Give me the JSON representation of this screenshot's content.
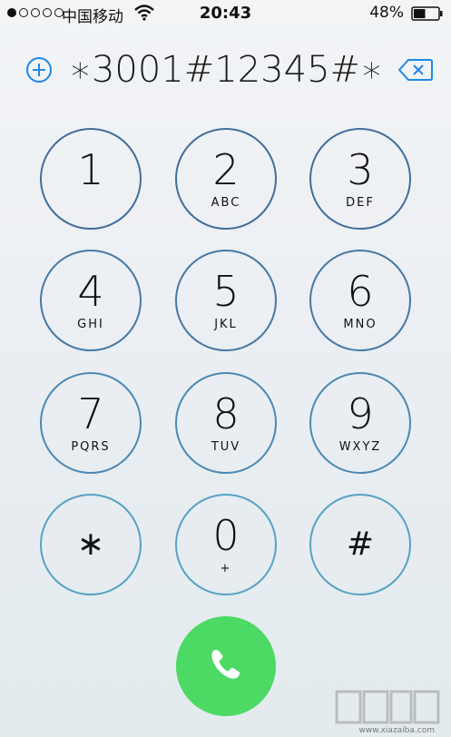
{
  "status_bar": {
    "carrier": "中国移动",
    "time": "20:43",
    "battery_percent": "48%",
    "battery_level": 0.48,
    "signal_bars_filled": 1,
    "signal_bars_total": 5
  },
  "dialer": {
    "number": "∗3001#12345#∗",
    "add_contact_icon": "plus-circle-icon",
    "backspace_icon": "backspace-icon"
  },
  "keys": [
    {
      "digit": "1",
      "letters": ""
    },
    {
      "digit": "2",
      "letters": "ABC"
    },
    {
      "digit": "3",
      "letters": "DEF"
    },
    {
      "digit": "4",
      "letters": "GHI"
    },
    {
      "digit": "5",
      "letters": "JKL"
    },
    {
      "digit": "6",
      "letters": "MNO"
    },
    {
      "digit": "7",
      "letters": "PQRS"
    },
    {
      "digit": "8",
      "letters": "TUV"
    },
    {
      "digit": "9",
      "letters": "WXYZ"
    },
    {
      "digit": "∗",
      "letters": ""
    },
    {
      "digit": "0",
      "letters": "+"
    },
    {
      "digit": "#",
      "letters": ""
    }
  ],
  "call": {
    "icon": "phone-icon",
    "color": "#4cd964"
  },
  "colors": {
    "key_ring_top": "#3e6d9d",
    "key_ring_bottom": "#58a7c7",
    "accent": "#1e88e5"
  },
  "watermark": {
    "url": "www.xiazaiba.com"
  }
}
